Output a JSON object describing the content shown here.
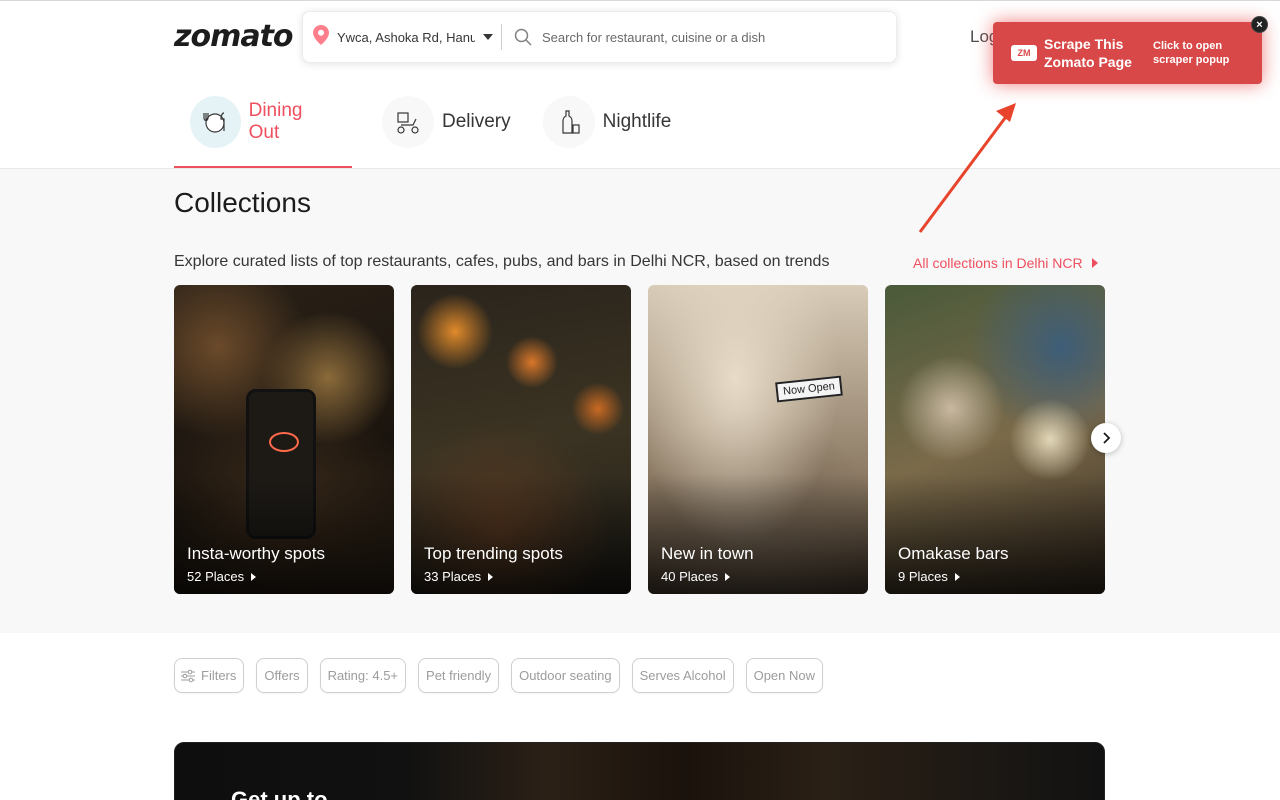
{
  "header": {
    "logo": "zomato",
    "location": "Ywca, Ashoka Rd, Hanuman",
    "search_placeholder": "Search for restaurant, cuisine or a dish",
    "login_label": "Log"
  },
  "tabs": [
    {
      "label": "Dining Out",
      "icon": "dining-icon",
      "active": true
    },
    {
      "label": "Delivery",
      "icon": "delivery-scooter-icon",
      "active": false
    },
    {
      "label": "Nightlife",
      "icon": "nightlife-bottle-icon",
      "active": false
    }
  ],
  "collections": {
    "title": "Collections",
    "subtitle": "Explore curated lists of top restaurants, cafes, pubs, and bars in Delhi NCR, based on trends",
    "all_link": "All collections in Delhi NCR",
    "cards": [
      {
        "title": "Insta-worthy spots",
        "count": "52 Places"
      },
      {
        "title": "Top trending spots",
        "count": "33 Places"
      },
      {
        "title": "New in town",
        "count": "40 Places",
        "sign": "Now Open"
      },
      {
        "title": "Omakase bars",
        "count": "9 Places"
      }
    ]
  },
  "filters": [
    "Filters",
    "Offers",
    "Rating: 4.5+",
    "Pet friendly",
    "Outdoor seating",
    "Serves Alcohol",
    "Open Now"
  ],
  "banner": {
    "text": "Get up to"
  },
  "extension": {
    "badge": "ZM",
    "title": "Scrape This Zomato Page",
    "subtitle": "Click to open scraper popup",
    "close": "×",
    "color": "#d94848"
  },
  "colors": {
    "accent": "#ef4f5f",
    "extension": "#d94848",
    "arrow": "#e8442c"
  }
}
